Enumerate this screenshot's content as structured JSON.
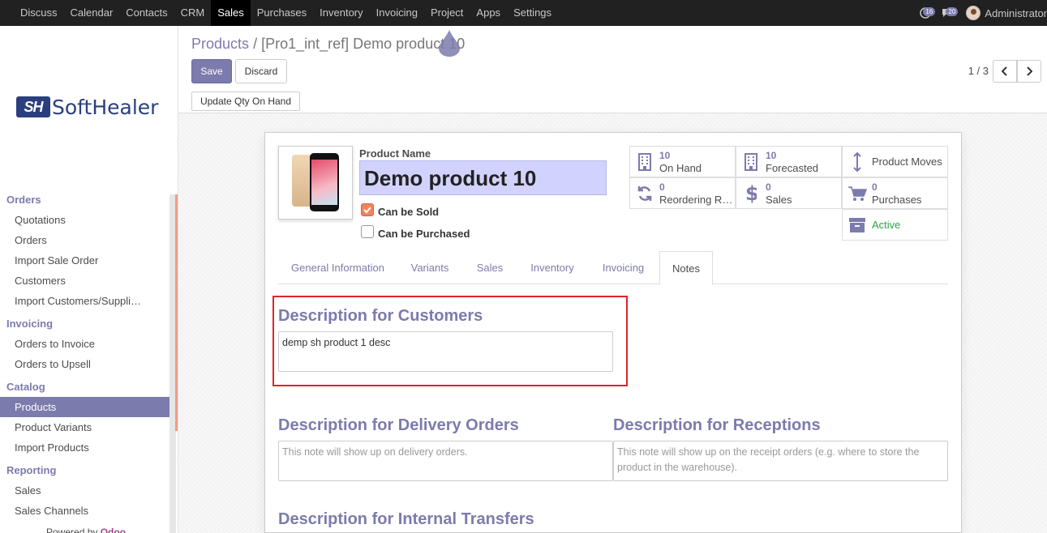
{
  "topnav": {
    "menu": [
      "Discuss",
      "Calendar",
      "Contacts",
      "CRM",
      "Sales",
      "Purchases",
      "Inventory",
      "Invoicing",
      "Project",
      "Apps",
      "Settings"
    ],
    "active": "Sales",
    "badge_activity": "16",
    "badge_messages": "20",
    "user": "Administrator"
  },
  "sidebar": {
    "logo_mark": "SH",
    "logo_text": "SoftHealer",
    "sections": [
      {
        "header": "Orders",
        "items": [
          "Quotations",
          "Orders",
          "Import Sale Order",
          "Customers",
          "Import Customers/Suppli…"
        ]
      },
      {
        "header": "Invoicing",
        "items": [
          "Orders to Invoice",
          "Orders to Upsell"
        ]
      },
      {
        "header": "Catalog",
        "items": [
          "Products",
          "Product Variants",
          "Import Products"
        ]
      },
      {
        "header": "Reporting",
        "items": [
          "Sales",
          "Sales Channels"
        ]
      }
    ],
    "active_item": "Products",
    "powered_by": "Powered by",
    "powered_brand": "Odoo"
  },
  "control": {
    "breadcrumb_root": "Products",
    "breadcrumb_sep": "/",
    "breadcrumb_current": "[Pro1_int_ref] Demo product 10",
    "save_label": "Save",
    "discard_label": "Discard",
    "pager": "1 / 3",
    "update_qty_label": "Update Qty On Hand"
  },
  "product": {
    "name_label": "Product Name",
    "name": "Demo product 10",
    "can_be_sold_label": "Can be Sold",
    "can_be_sold": true,
    "can_be_purchased_label": "Can be Purchased",
    "can_be_purchased": false
  },
  "stats": {
    "on_hand_num": "10",
    "on_hand_label": "On Hand",
    "forecasted_num": "10",
    "forecasted_label": "Forecasted",
    "moves_label": "Product Moves",
    "reordering_num": "0",
    "reordering_label": "Reordering R…",
    "sales_num": "0",
    "sales_label": "Sales",
    "purchases_num": "0",
    "purchases_label": "Purchases",
    "active_label": "Active"
  },
  "tabs": [
    "General Information",
    "Variants",
    "Sales",
    "Inventory",
    "Invoicing",
    "Notes"
  ],
  "active_tab": "Notes",
  "notes": {
    "customers_title": "Description for Customers",
    "customers_value": "demp sh product 1 desc",
    "delivery_title": "Description for Delivery Orders",
    "delivery_placeholder": "This note will show up on delivery orders.",
    "receptions_title": "Description for Receptions",
    "receptions_placeholder": "This note will show up on the receipt orders (e.g. where to store the product in the warehouse).",
    "internal_title": "Description for Internal Transfers"
  },
  "colors": {
    "accent": "#7c7bad",
    "topbar": "#212121",
    "highlight_box": "#e2232a",
    "checkbox": "#f0845c",
    "active_green": "#28a745"
  }
}
